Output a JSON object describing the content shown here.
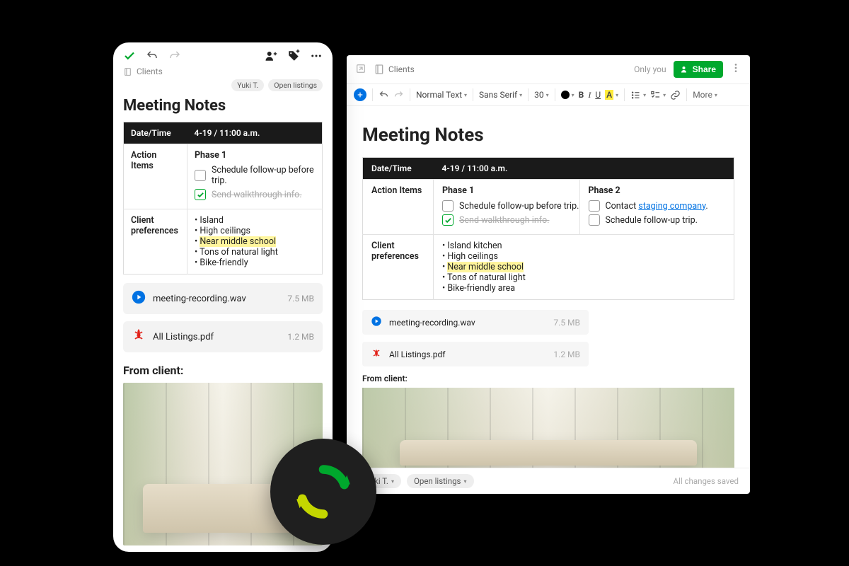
{
  "mobile": {
    "breadcrumb": "Clients",
    "tags": [
      "Yuki T.",
      "Open listings"
    ],
    "title": "Meeting Notes",
    "table": {
      "header_left": "Date/Time",
      "header_right": "4-19 / 11:00 a.m.",
      "action_items_label": "Action Items",
      "phase1_label": "Phase 1",
      "task1": "Schedule follow-up before trip.",
      "task2": "Send walkthrough info.",
      "prefs_label": "Client preferences",
      "prefs": [
        "Island",
        "High ceilings",
        "Near middle school",
        "Tons of natural light",
        "Bike-friendly"
      ],
      "prefs_highlight_index": 2
    },
    "attachments": [
      {
        "name": "meeting-recording.wav",
        "size": "7.5 MB",
        "type": "audio"
      },
      {
        "name": "All Listings.pdf",
        "size": "1.2 MB",
        "type": "pdf"
      }
    ],
    "from_client_label": "From client:"
  },
  "desktop": {
    "breadcrumb": "Clients",
    "only_you": "Only you",
    "share_label": "Share",
    "toolbar": {
      "style": "Normal Text",
      "font": "Sans Serif",
      "size": "30",
      "more": "More"
    },
    "title": "Meeting Notes",
    "table": {
      "header_left": "Date/Time",
      "header_right": "4-19 / 11:00 a.m.",
      "action_items_label": "Action Items",
      "phase1_label": "Phase 1",
      "p1_task1": "Schedule follow-up before trip.",
      "p1_task2": "Send walkthrough info.",
      "phase2_label": "Phase 2",
      "p2_task1_pre": "Contact ",
      "p2_task1_link": "staging company",
      "p2_task1_post": ".",
      "p2_task2": "Schedule follow-up trip.",
      "prefs_label": "Client preferences",
      "prefs": [
        "Island kitchen",
        "High ceilings",
        "Near middle school",
        "Tons of natural light",
        "Bike-friendly area"
      ],
      "prefs_highlight_index": 2
    },
    "attachments": [
      {
        "name": "meeting-recording.wav",
        "size": "7.5 MB",
        "type": "audio"
      },
      {
        "name": "All Listings.pdf",
        "size": "1.2 MB",
        "type": "pdf"
      }
    ],
    "from_client_label": "From client:",
    "footer_tags": [
      "Yuki T.",
      "Open listings"
    ],
    "saved_status": "All changes saved"
  }
}
